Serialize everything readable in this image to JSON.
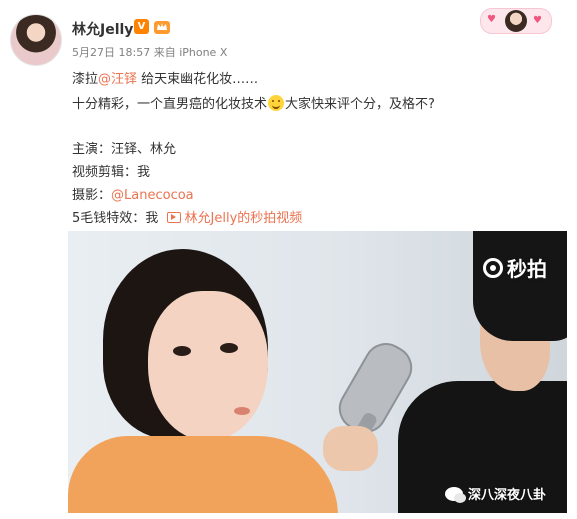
{
  "post": {
    "username": "林允Jelly",
    "verified_badge": "V",
    "member_icon": "crown-icon",
    "timestamp": "5月27日 18:57",
    "source": "来自 iPhone X",
    "line1_prefix": "漆拉",
    "line1_mention": "@汪铎",
    "line1_suffix": "给天束幽花化妆……",
    "line2_text_before": "十分精彩，一个直男癌的化妆技术",
    "line2_emoji": "smile-emoji-icon",
    "line2_text_after": "大家快来评个分，及格不?",
    "credit_1": "主演：汪铎、林允",
    "credit_2": "视频剪辑：我",
    "credit_3_label": "摄影：",
    "credit_3_link": "@Lanecocoa",
    "credit_4_label": "5毛钱特效：我",
    "credit_4_link": "林允Jelly的秒拍视频"
  },
  "video": {
    "brand_label": "秒拍",
    "watermark": "深八深夜八卦"
  },
  "colors": {
    "link": "#eb7350",
    "badge": "#ff8200",
    "text": "#333333",
    "meta": "#808080"
  }
}
